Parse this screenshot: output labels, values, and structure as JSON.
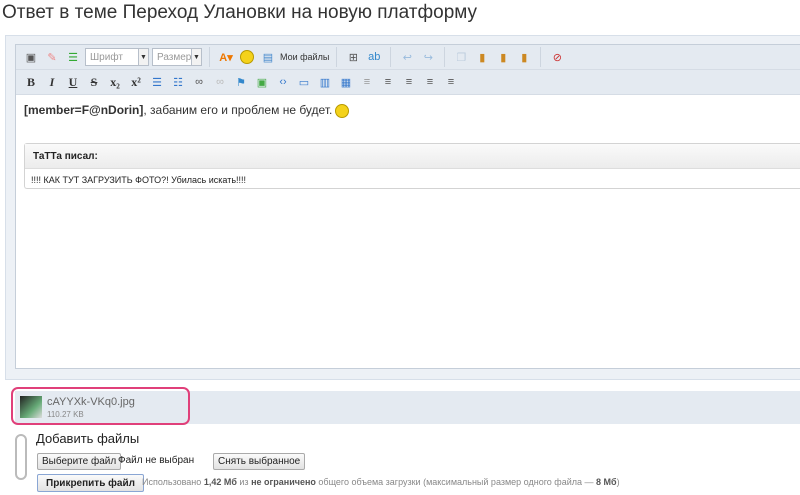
{
  "title": "Ответ в теме Переход Улановки на новую платформу",
  "toolbar": {
    "font_placeholder": "Шрифт",
    "size_placeholder": "Размер",
    "my_files": "Мои файлы"
  },
  "editor": {
    "member_tag": "[member=F@nDorin]",
    "message": ", забаним его и проблем не будет.",
    "quote_author": "ТаТТа писал:",
    "quote_text": "!!!! КАК ТУТ ЗАГРУЗИТЬ ФОТО?! Убилась искать!!!!"
  },
  "attachment": {
    "name": "cAYYXk-VKq0.jpg",
    "size": "110.27 KB"
  },
  "upload": {
    "heading": "Добавить файлы",
    "choose_button": "Выберите файл",
    "no_file": "Файл не выбран",
    "clear_button": "Снять выбранное",
    "attach_button": "Прикрепить файл",
    "usage_prefix": "Использовано",
    "used": "1,42 Мб",
    "usage_mid": "из",
    "limit": "не ограничено",
    "usage_suffix": "общего объема загрузки (максимальный размер одного файла —",
    "max_size": "8 Мб",
    "usage_end": ")"
  }
}
